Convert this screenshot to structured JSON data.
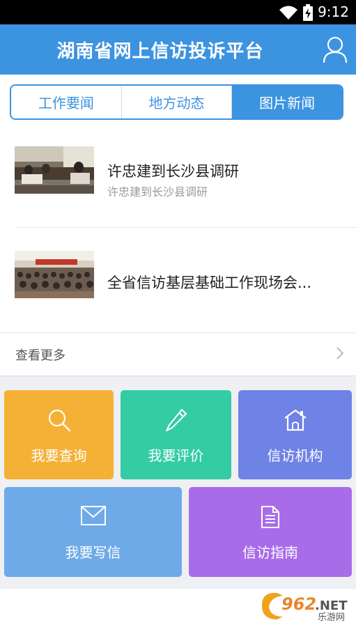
{
  "status_bar": {
    "time": "9:12"
  },
  "header": {
    "title": "湖南省网上信访投诉平台",
    "user_icon": "user-icon"
  },
  "tabs": [
    {
      "label": "工作要闻",
      "active": false
    },
    {
      "label": "地方动态",
      "active": false
    },
    {
      "label": "图片新闻",
      "active": true
    }
  ],
  "news": [
    {
      "title": "许忠建到长沙县调研",
      "subtitle": "许忠建到长沙县调研"
    },
    {
      "title": "全省信访基层基础工作现场会...",
      "subtitle": ""
    }
  ],
  "more": {
    "label": "查看更多"
  },
  "tiles": [
    {
      "label": "我要查询",
      "icon": "search-icon",
      "color": "#f5b136"
    },
    {
      "label": "我要评价",
      "icon": "pencil-icon",
      "color": "#34cca4"
    },
    {
      "label": "信访机构",
      "icon": "house-icon",
      "color": "#6f82e6"
    },
    {
      "label": "我要写信",
      "icon": "mail-icon",
      "color": "#6eaae8"
    },
    {
      "label": "信访指南",
      "icon": "document-icon",
      "color": "#a86ce9"
    }
  ],
  "watermark": {
    "brand": "962.NET",
    "sub": "乐游网"
  }
}
